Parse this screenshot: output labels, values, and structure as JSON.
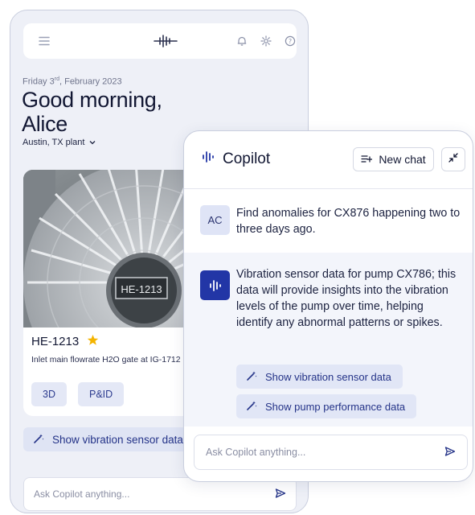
{
  "mobile": {
    "topbar": {
      "menu_icon": "hamburger-icon",
      "logo_icon": "brand-waveform-logo",
      "bell_icon": "bell-icon",
      "settings_icon": "gear-icon",
      "help_icon": "help-icon"
    },
    "date_prefix": "Friday 3",
    "date_suffix_sup": "rd",
    "date_rest": ", February 2023",
    "greeting_line1": "Good morning,",
    "greeting_line2": "Alice",
    "plant": "Austin, TX plant",
    "asset": {
      "photo_label": "HE-1213",
      "name": "HE-1213",
      "favorite": true,
      "description": "Inlet main flowrate H2O gate at IG-1712",
      "chips": [
        "3D",
        "P&ID"
      ]
    },
    "suggestion": "Show vibration sensor data",
    "input_placeholder": "Ask Copilot anything..."
  },
  "copilot": {
    "title": "Copilot",
    "new_chat_label": "New chat",
    "user_avatar": "AC",
    "user_message": "Find anomalies for CX876 happening two to three days ago.",
    "bot_message": "Vibration sensor data for pump CX786; this data will provide insights into the vibration levels of the pump over time, helping identify any abnormal patterns or spikes.",
    "actions": [
      "Show vibration sensor data",
      "Show pump performance data"
    ],
    "input_placeholder": "Ask Copilot anything..."
  },
  "colors": {
    "accent": "#2236a6",
    "chip_bg": "#e1e6f6",
    "star": "#f4b400"
  }
}
